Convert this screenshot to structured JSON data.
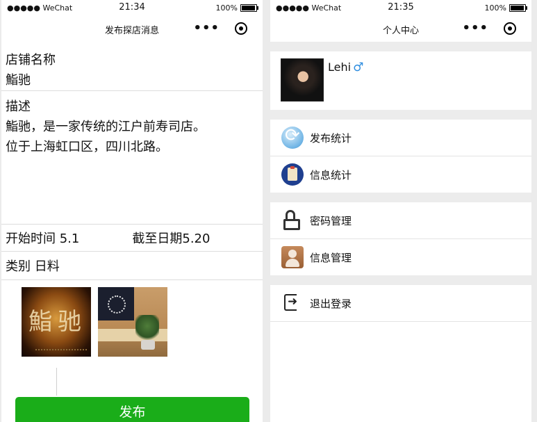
{
  "left_screen": {
    "status": {
      "signal": "●●●●● WeChat",
      "time": "21:34",
      "battery": "100%"
    },
    "nav": {
      "title": "发布探店消息",
      "more": "•••"
    },
    "shop_name_label": "店铺名称",
    "shop_name_value": "鮨驰",
    "description_label": "描述",
    "description_lines": [
      "鮨驰，是一家传统的江户前寿司店。",
      "位于上海虹口区，四川北路。"
    ],
    "start_label": "开始时间",
    "start_value": "5.1",
    "end_label": "截至日期",
    "end_value": "5.20",
    "category_label": "类别",
    "category_value": "日料",
    "photo1_text": "鮨驰",
    "publish_button": "发布"
  },
  "right_screen": {
    "status": {
      "signal": "●●●●● WeChat",
      "time": "21:35",
      "battery": "100%"
    },
    "nav": {
      "title": "个人中心",
      "more": "•••"
    },
    "user": {
      "name": "Lehi",
      "gender_symbol": "♂"
    },
    "menu_groups": [
      [
        {
          "icon": "refresh-icon",
          "label": "发布统计"
        },
        {
          "icon": "info-icon",
          "label": "信息统计"
        }
      ],
      [
        {
          "icon": "lock-icon",
          "label": "密码管理"
        },
        {
          "icon": "user-icon",
          "label": "信息管理"
        }
      ],
      [
        {
          "icon": "exit-icon",
          "label": "退出登录"
        }
      ]
    ]
  }
}
